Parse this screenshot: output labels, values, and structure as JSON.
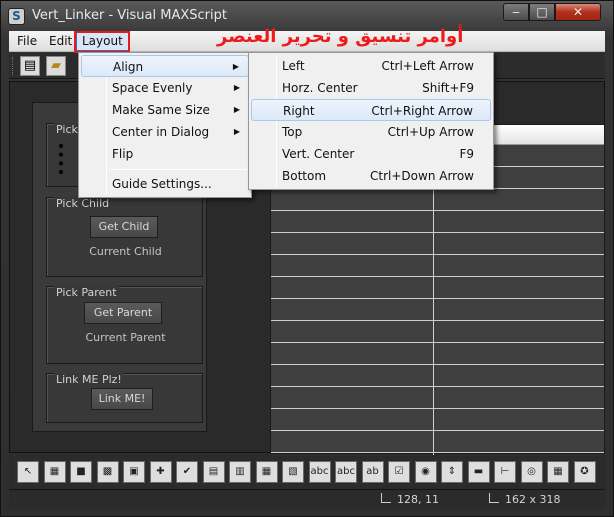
{
  "window": {
    "title": "Vert_Linker - Visual MAXScript",
    "app_icon_glyph": "S",
    "minimize": "‒",
    "maximize": "□",
    "close": "✕"
  },
  "menubar": {
    "file": "File",
    "edit": "Edit",
    "layout": "Layout"
  },
  "annotation": "أوامر تنسيق و تحرير العنصر",
  "toolbar": {
    "new_icon": "new-file-icon",
    "open_icon": "open-folder-icon"
  },
  "rollout": {
    "groups": [
      {
        "label": "Pick"
      },
      {
        "label": "Pick Child",
        "button": "Get Child",
        "caption": "Current Child"
      },
      {
        "label": "Pick Parent",
        "button": "Get Parent",
        "caption": "Current Parent"
      },
      {
        "label": "Link ME Plz!",
        "button": "Link ME!"
      }
    ]
  },
  "layout_menu": {
    "items": [
      {
        "label": "Align",
        "submenu": true
      },
      {
        "label": "Space Evenly",
        "submenu": true
      },
      {
        "label": "Make Same Size",
        "submenu": true
      },
      {
        "label": "Center in Dialog",
        "submenu": true
      },
      {
        "label": "Flip",
        "submenu": false
      },
      {
        "label": "Guide Settings...",
        "submenu": false
      }
    ]
  },
  "align_menu": {
    "items": [
      {
        "label": "Left",
        "shortcut": "Ctrl+Left Arrow"
      },
      {
        "label": "Horz. Center",
        "shortcut": "Shift+F9"
      },
      {
        "label": "Right",
        "shortcut": "Ctrl+Right Arrow"
      },
      {
        "label": "Top",
        "shortcut": "Ctrl+Up Arrow"
      },
      {
        "label": "Vert. Center",
        "shortcut": "F9"
      },
      {
        "label": "Bottom",
        "shortcut": "Ctrl+Down Arrow"
      }
    ]
  },
  "statusbar": {
    "position": "128, 11",
    "size": "162 x 318"
  },
  "bottom_icons": [
    "pointer-icon",
    "bitmap-icon",
    "box-icon",
    "checker-icon",
    "color-icon",
    "plus-icon",
    "check-icon",
    "palette-icon",
    "grid-icon",
    "list-icon",
    "image-icon",
    "label-icon",
    "text-icon",
    "edit-icon",
    "checkbox-icon",
    "radio-icon",
    "spinner-icon",
    "progress-icon",
    "slider-icon",
    "timer-icon",
    "activex-icon",
    "extra-icon"
  ],
  "bottom_glyphs": [
    "↖",
    "▦",
    "■",
    "▩",
    "▣",
    "✚",
    "✔",
    "▤",
    "▥",
    "▦",
    "▧",
    "abc",
    "abc",
    "ab",
    "☑",
    "◉",
    "⇕",
    "▬",
    "⊢",
    "◎",
    "▦",
    "✪"
  ]
}
